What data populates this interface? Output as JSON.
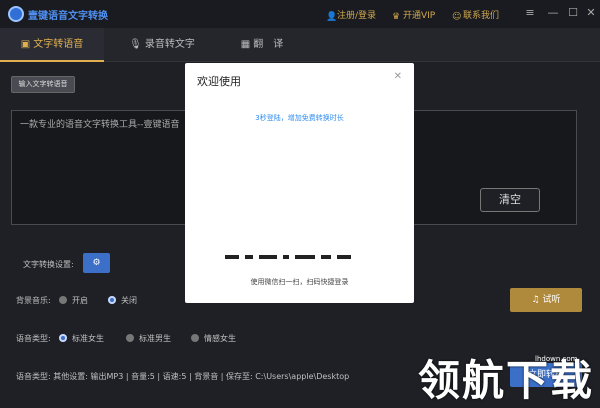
{
  "app": {
    "title": "壹键语音文字转换"
  },
  "titlebar": {
    "login": "注册/登录",
    "vip": "开通VIP",
    "contact": "联系我们"
  },
  "tabs": [
    {
      "label": "文字转语音",
      "icon": "document-icon"
    },
    {
      "label": "录音转文字",
      "icon": "microphone-icon"
    },
    {
      "label": "翻　译",
      "icon": "translate-icon"
    }
  ],
  "input_button": {
    "label": "输入文字转语音"
  },
  "editor": {
    "text": "一款专业的语音文字转换工具--壹键语音"
  },
  "clear_button": {
    "label": "清空"
  },
  "settings": {
    "label": "文字转换设置:",
    "button_icon": "gear-icon"
  },
  "bgm": {
    "label": "背景音乐:",
    "options": [
      {
        "label": "开启",
        "selected": false
      },
      {
        "label": "关闭",
        "selected": true
      }
    ]
  },
  "voice": {
    "label": "语音类型:",
    "options": [
      {
        "label": "标准女生",
        "selected": true
      },
      {
        "label": "标准男生",
        "selected": false
      },
      {
        "label": "情感女生",
        "selected": false
      }
    ]
  },
  "play_button": {
    "label": "试听"
  },
  "convert_button": {
    "label": "立即转换"
  },
  "status": {
    "text": "语音类型:  其他设置:  输出MP3 |  音量:5 |  语速:5 |  背景音 |  保存至:  C:\\Users\\apple\\Desktop"
  },
  "modal": {
    "title": "欢迎使用",
    "hint": "3秒登陆，增加免费转换时长",
    "footer": "使用微信扫一扫，扫码快捷登录"
  },
  "watermark": {
    "text": "领航下载",
    "site": "lhdown.com"
  },
  "colors": {
    "accent": "#e0b050",
    "primary": "#3b6fc8",
    "background": "#1f2026"
  }
}
